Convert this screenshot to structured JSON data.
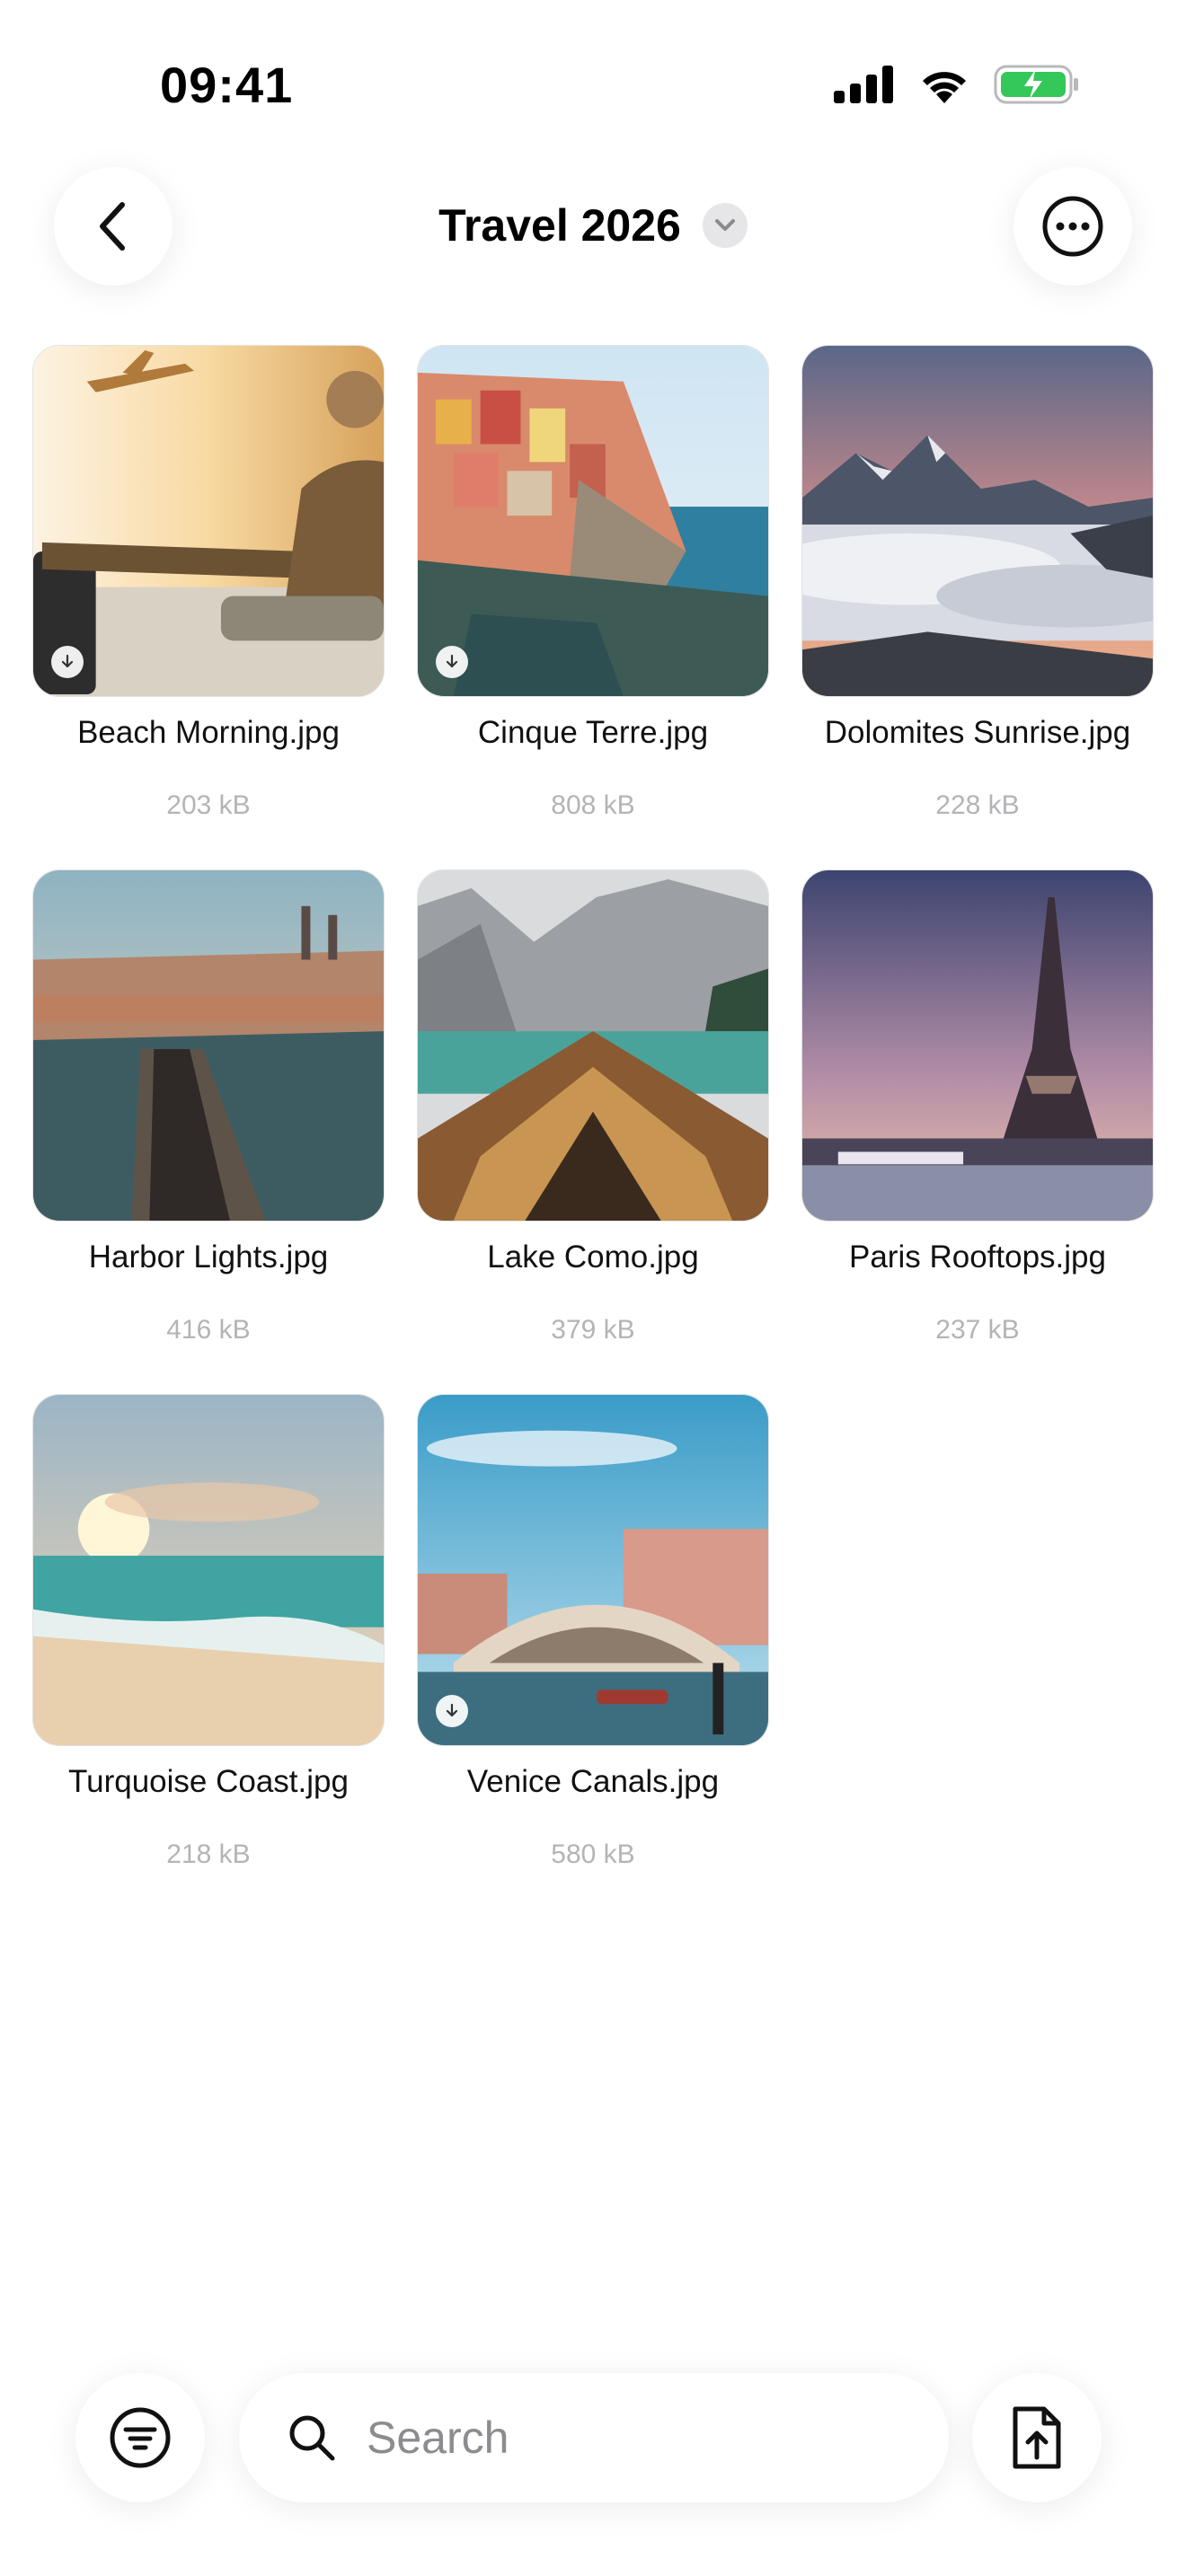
{
  "status_bar": {
    "time": "09:41"
  },
  "header": {
    "title": "Travel 2026"
  },
  "files": [
    {
      "name": "Beach Morning.jpg",
      "size": "203 kB",
      "downloadable": true
    },
    {
      "name": "Cinque Terre.jpg",
      "size": "808 kB",
      "downloadable": true
    },
    {
      "name": "Dolomites Sunrise.jpg",
      "size": "228 kB",
      "downloadable": false
    },
    {
      "name": "Harbor Lights.jpg",
      "size": "416 kB",
      "downloadable": false
    },
    {
      "name": "Lake Como.jpg",
      "size": "379 kB",
      "downloadable": false
    },
    {
      "name": "Paris Rooftops.jpg",
      "size": "237 kB",
      "downloadable": false
    },
    {
      "name": "Turquoise Coast.jpg",
      "size": "218 kB",
      "downloadable": false
    },
    {
      "name": "Venice Canals.jpg",
      "size": "580 kB",
      "downloadable": true
    }
  ],
  "search": {
    "placeholder": "Search"
  },
  "icons": {
    "back": "chevron-left-icon",
    "more": "ellipsis-circle-icon",
    "title_dropdown": "chevron-down-icon",
    "filter": "filter-circle-icon",
    "search": "search-icon",
    "upload": "document-upload-icon",
    "download_badge": "download-arrow-icon"
  },
  "colors": {
    "battery": "#34c759",
    "muted_text": "#b4b4b8"
  }
}
